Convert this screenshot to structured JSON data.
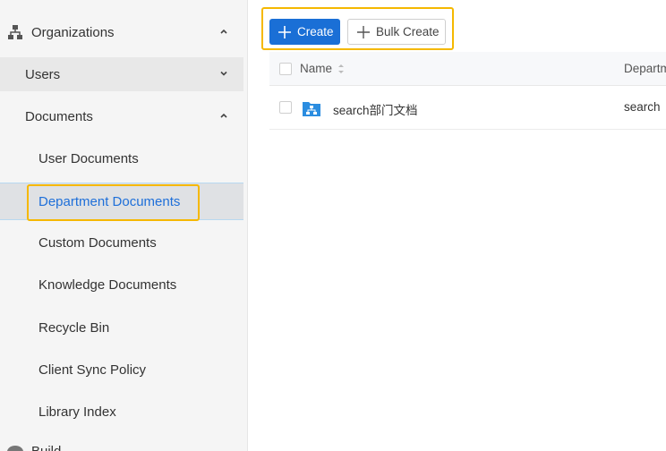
{
  "sidebar": {
    "organizations_label": "Organizations",
    "users_label": "Users",
    "documents_label": "Documents",
    "document_items": [
      {
        "label": "User Documents"
      },
      {
        "label": "Department Documents",
        "active": true
      },
      {
        "label": "Custom Documents"
      },
      {
        "label": "Knowledge Documents"
      },
      {
        "label": "Recycle Bin"
      },
      {
        "label": "Client Sync Policy"
      },
      {
        "label": "Library Index"
      }
    ],
    "bottom_label": "Build"
  },
  "toolbar": {
    "create_label": "Create",
    "bulk_create_label": "Bulk Create"
  },
  "table": {
    "columns": [
      "Name",
      "Departm"
    ],
    "rows": [
      {
        "name": "search部门文档",
        "department": "search"
      }
    ]
  },
  "colors": {
    "accent": "#1a6fd6",
    "highlight": "#f5b800",
    "active_text": "#1e6fd9"
  },
  "icons": {
    "organizations": "org-tree-icon",
    "expand": "chevron-icon",
    "sort": "sort-icon",
    "add": "plus-icon",
    "department_doc": "department-folder-icon"
  }
}
